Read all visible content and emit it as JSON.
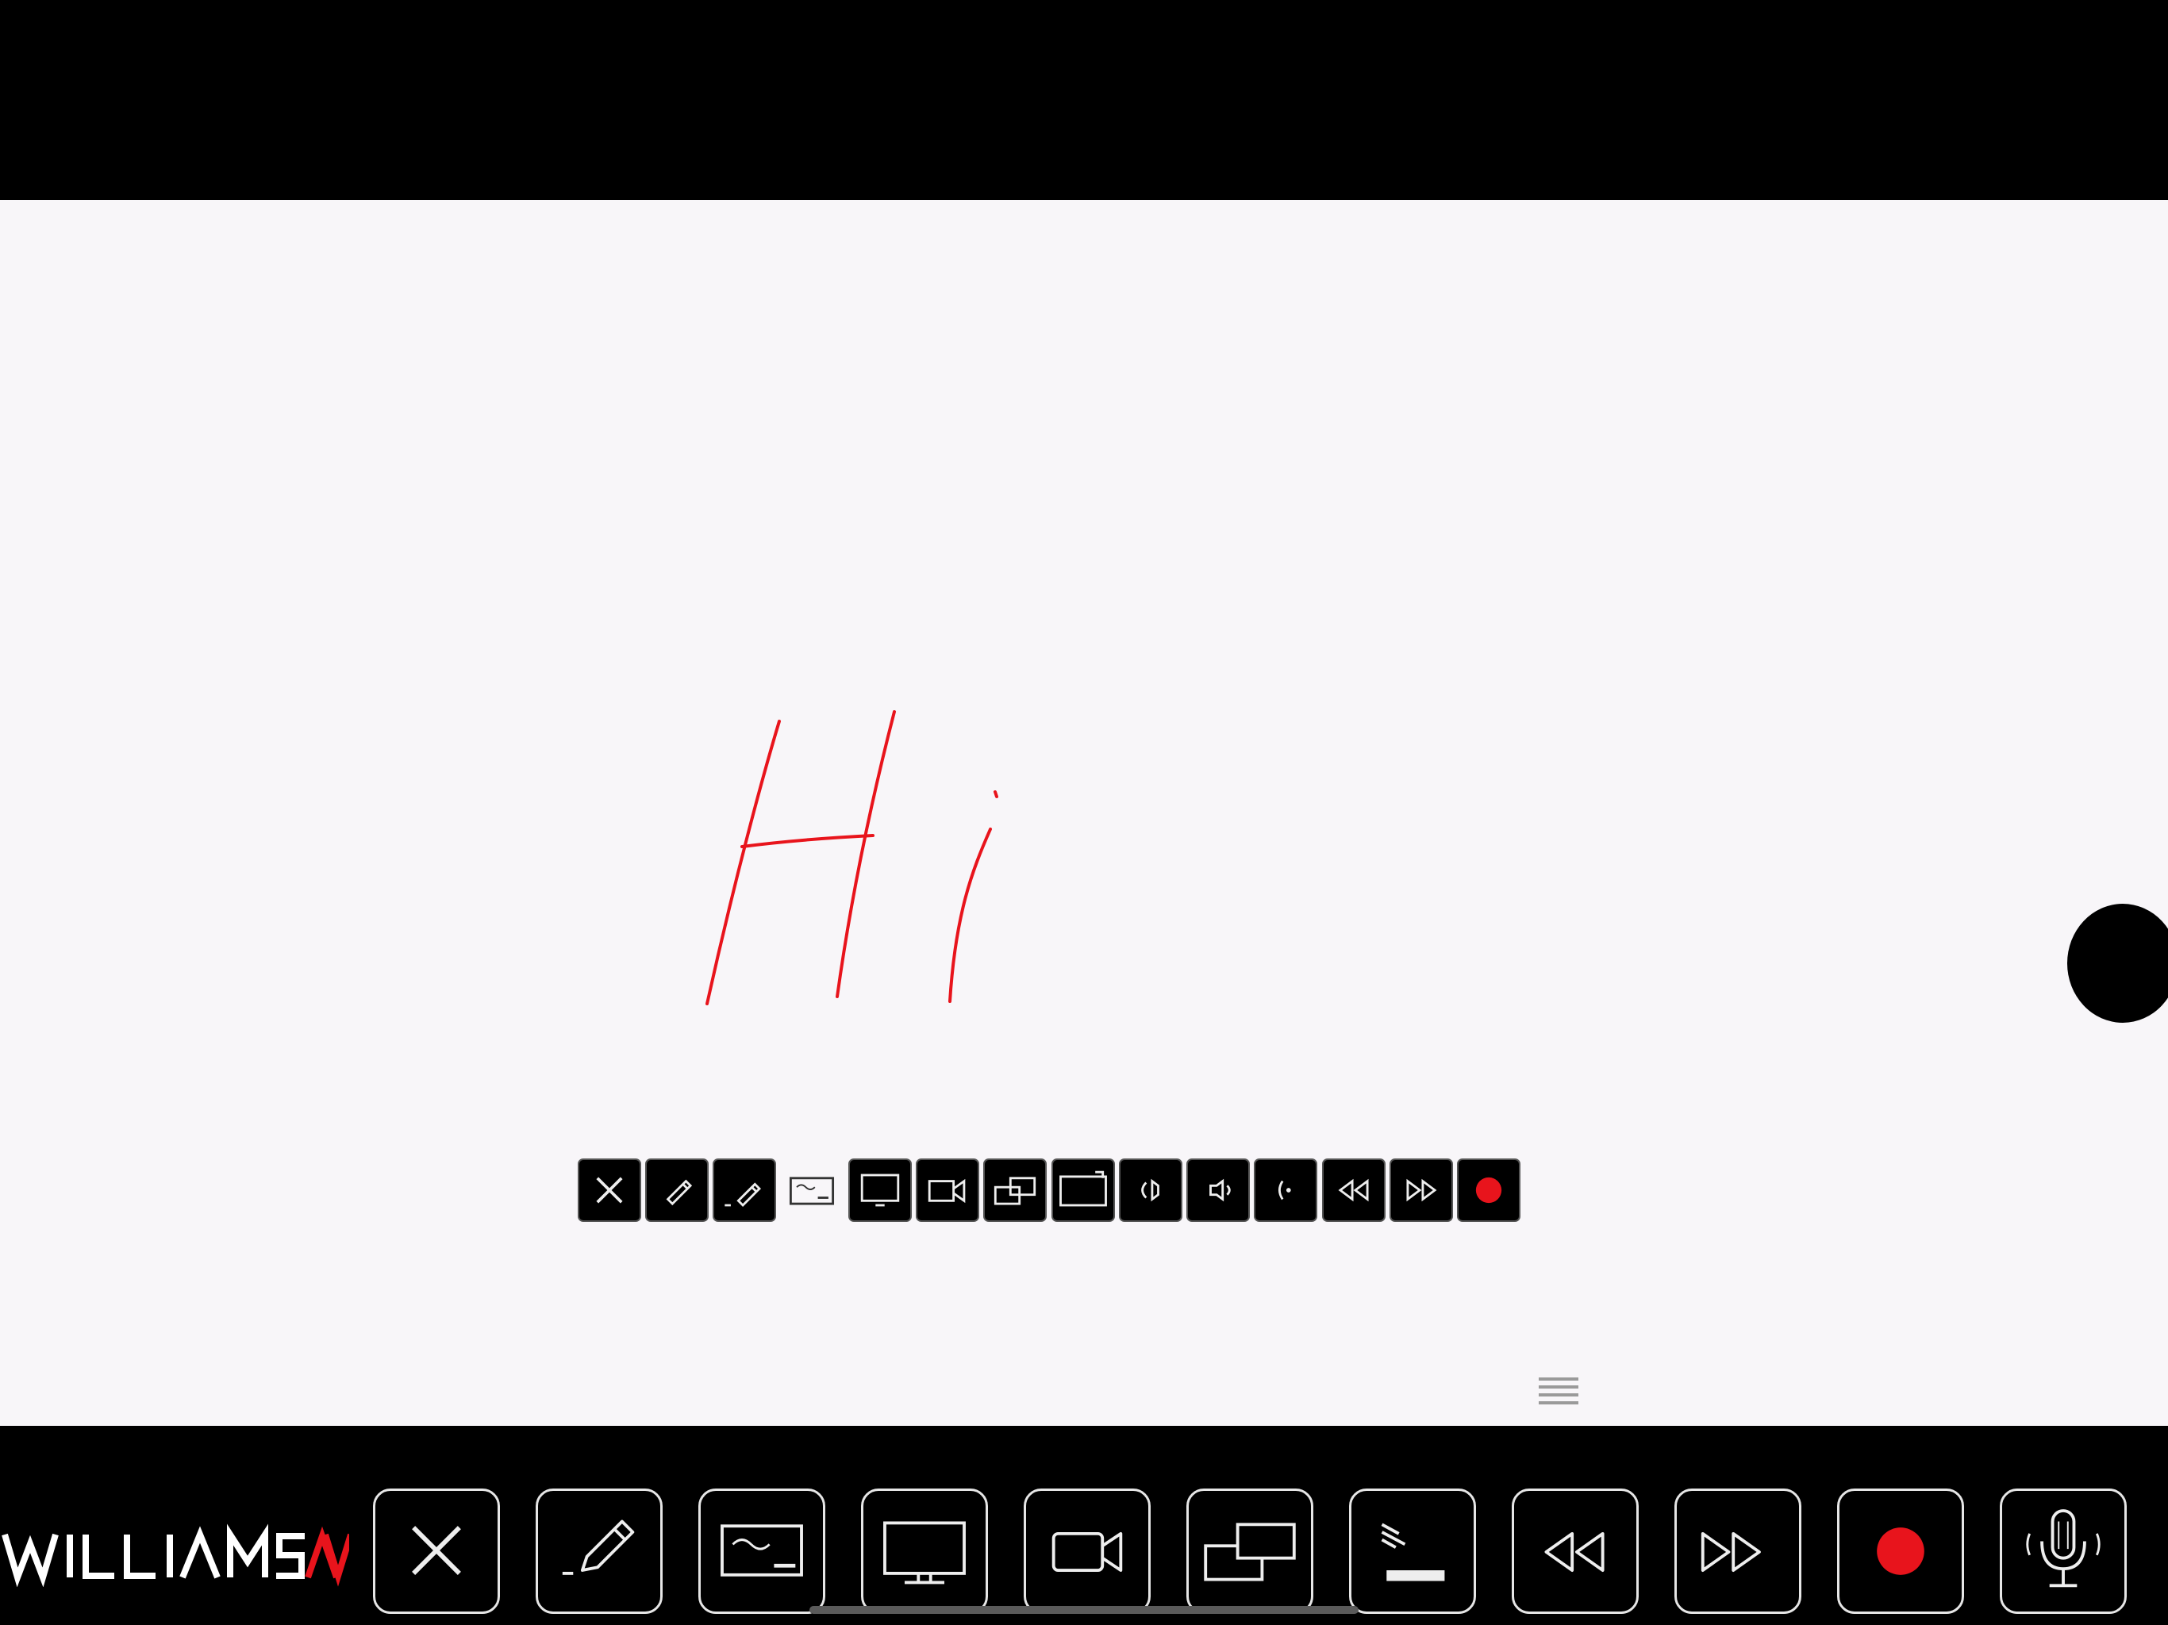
{
  "app": {
    "brand": "WILLIAMSAV"
  },
  "canvas": {
    "background": "#f8f6f9",
    "ink_color": "#e8141c"
  },
  "mini_toolbar": {
    "items": [
      {
        "name": "close-icon",
        "active": false
      },
      {
        "name": "pen-icon",
        "active": false
      },
      {
        "name": "laser-pen-icon",
        "active": false
      },
      {
        "name": "whiteboard-icon",
        "active": true
      },
      {
        "name": "monitor-icon",
        "active": false
      },
      {
        "name": "camera-icon",
        "active": false
      },
      {
        "name": "dual-screen-icon",
        "active": false
      },
      {
        "name": "screen-share-icon",
        "active": false
      },
      {
        "name": "speaker-left-icon",
        "active": false
      },
      {
        "name": "speaker-right-icon",
        "active": false
      },
      {
        "name": "dot-icon",
        "active": false
      },
      {
        "name": "rewind-icon",
        "active": false
      },
      {
        "name": "fast-forward-icon",
        "active": false
      },
      {
        "name": "record-icon",
        "active": false
      }
    ],
    "menu_icon": "hamburger-icon"
  },
  "toolbar": {
    "buttons": [
      {
        "name": "close-icon"
      },
      {
        "name": "pen-icon"
      },
      {
        "name": "whiteboard-icon"
      },
      {
        "name": "monitor-icon"
      },
      {
        "name": "camera-icon"
      },
      {
        "name": "dual-screen-icon"
      },
      {
        "name": "presentation-icon"
      },
      {
        "name": "rewind-icon"
      },
      {
        "name": "fast-forward-icon"
      },
      {
        "name": "record-icon"
      },
      {
        "name": "microphone-icon"
      }
    ],
    "accent_color": "#e8141c",
    "button_border_color": "#e6e6e6"
  }
}
